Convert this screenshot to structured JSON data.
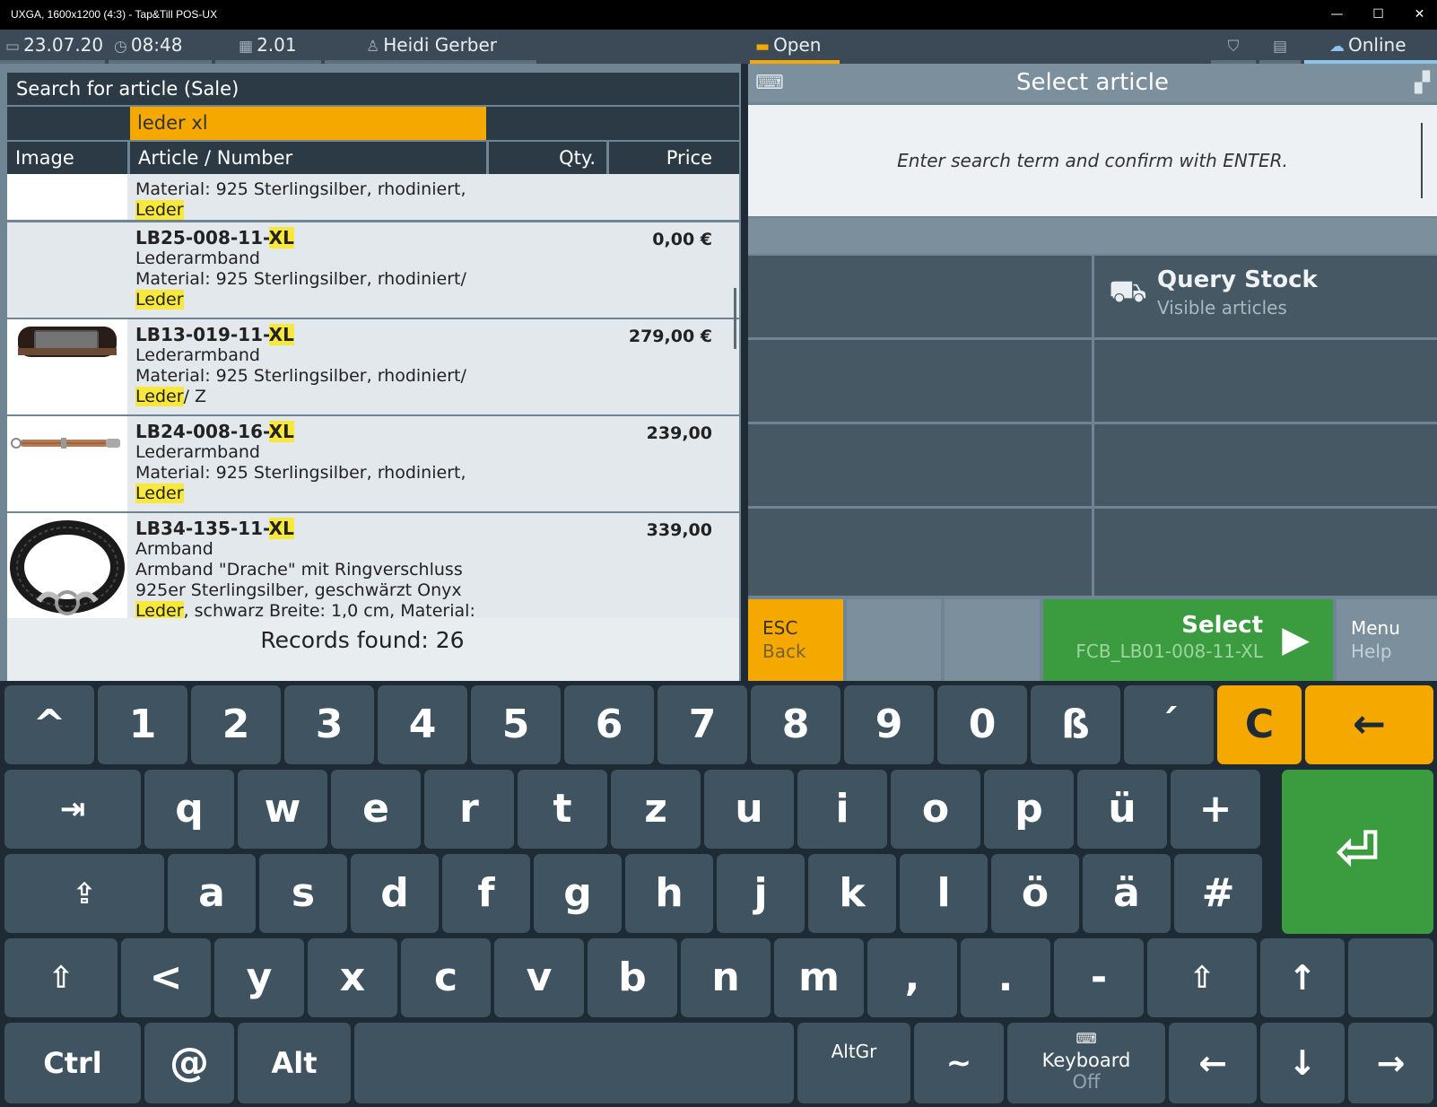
{
  "window": {
    "title": "UXGA, 1600x1200 (4:3) - Tap&Till POS-UX",
    "minimize": "—",
    "maximize": "☐",
    "close": "✕"
  },
  "status": {
    "date": "23.07.20",
    "time": "08:48",
    "register": "2.01",
    "user": "Heidi Gerber",
    "drawer": "Open",
    "online": "Online"
  },
  "search": {
    "header": "Search for article (Sale)",
    "query": "leder xl",
    "columns": {
      "image": "Image",
      "article": "Article / Number",
      "qty": "Qty.",
      "price": "Price"
    },
    "rows": [
      {
        "line1": "Material: 925 Sterlingsilber, rhodiniert,",
        "hl": "Leder"
      },
      {
        "num": "LB25-008-11-",
        "numhl": "XL",
        "name": "Lederarmband",
        "desc": "Material: 925 Sterlingsilber, rhodiniert/",
        "hl": "Leder",
        "tail": "",
        "price": "0,00 €"
      },
      {
        "num": "LB13-019-11-",
        "numhl": "XL",
        "name": "Lederarmband",
        "desc": "Material: 925 Sterlingsilber, rhodiniert/",
        "hl": "Leder",
        "tail": "/ Z",
        "price": "279,00 €"
      },
      {
        "num": "LB24-008-16-",
        "numhl": "XL",
        "name": "Lederarmband",
        "desc": "Material: 925 Sterlingsilber, rhodiniert,",
        "hl": "Leder",
        "tail": "",
        "price": "239,00"
      },
      {
        "num": "LB34-135-11-",
        "numhl": "XL",
        "name": "Armband",
        "desc": "Armband \"Drache\" mit Ringverschluss",
        "desc2": "925er Sterlingsilber, geschwärzt Onyx",
        "hl": "Leder",
        "tail": ", schwarz Breite: 1,0 cm, Material:",
        "price": "339,00"
      }
    ],
    "records": "Records found: 26"
  },
  "right": {
    "title": "Select article",
    "prompt": "Enter search term and confirm with ENTER.",
    "query_stock_title": "Query Stock",
    "query_stock_sub": "Visible articles",
    "esc": "ESC",
    "back": "Back",
    "select": "Select",
    "select_sub": "FCB_LB01-008-11-XL",
    "menu": "Menu",
    "help": "Help"
  },
  "keys": {
    "row1": [
      "^",
      "1",
      "2",
      "3",
      "4",
      "5",
      "6",
      "7",
      "8",
      "9",
      "0",
      "ß",
      "´",
      "C",
      "←"
    ],
    "row2": [
      "⇥",
      "q",
      "w",
      "e",
      "r",
      "t",
      "z",
      "u",
      "i",
      "o",
      "p",
      "ü",
      "+"
    ],
    "row3": [
      "⇪",
      "a",
      "s",
      "d",
      "f",
      "g",
      "h",
      "j",
      "k",
      "l",
      "ö",
      "ä",
      "#"
    ],
    "row4": [
      "⇧",
      "<",
      "y",
      "x",
      "c",
      "v",
      "b",
      "n",
      "m",
      ",",
      ".",
      "-",
      "⇧",
      "↑",
      ""
    ],
    "row5": {
      "ctrl": "Ctrl",
      "at": "@",
      "alt": "Alt",
      "altgr": "AltGr",
      "tilde": "~",
      "keyboard": "Keyboard",
      "keyboard_sub": "Off",
      "left": "←",
      "down": "↓",
      "right": "→"
    },
    "enter": "⏎"
  },
  "colors": {
    "accent": "#f5a800",
    "green": "#3a9c3f",
    "highlight": "#f8e83a",
    "panel": "#6f8593"
  }
}
